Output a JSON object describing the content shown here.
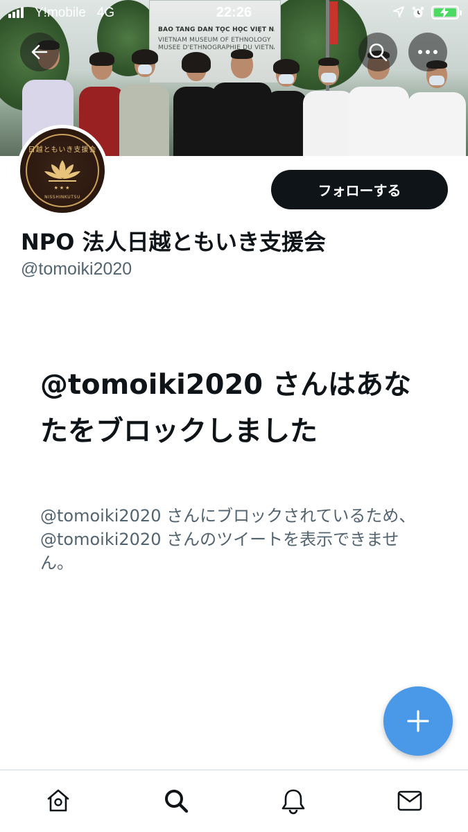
{
  "status_bar": {
    "carrier": "Y!mobile",
    "network": "4G",
    "time": "22:26"
  },
  "banner": {
    "sign_line1": "BẢO TÀNG DÂN TỘC HỌC VIỆT NAM",
    "sign_line2": "VIETNAM MUSEUM OF ETHNOLOGY",
    "sign_line3": "MUSÉE D'ETHNOGRAPHIE DU VIETNAM"
  },
  "avatar": {
    "logo_top": "日越ともいき支援会",
    "logo_stars": "★★★",
    "logo_bottom": "NISSHINKUTSU"
  },
  "profile": {
    "follow_label": "フォローする",
    "display_name": "NPO 法人日越ともいき支援会",
    "handle": "@tomoiki2020"
  },
  "blocked": {
    "title": "@tomoiki2020 さんはあなたをブロックしました",
    "description": "@tomoiki2020 さんにブロックされているため、@tomoiki2020 さんのツイートを表示できません。"
  },
  "icons": {
    "back": "back-arrow-icon",
    "search": "search-icon",
    "more": "more-icon",
    "compose": "plus-icon",
    "home": "home-icon",
    "explore": "search-icon",
    "notifications": "bell-icon",
    "messages": "mail-icon"
  },
  "colors": {
    "fab": "#4a99e9",
    "follow_button": "#0f1419",
    "secondary_text": "#536471",
    "battery": "#4cd964"
  }
}
